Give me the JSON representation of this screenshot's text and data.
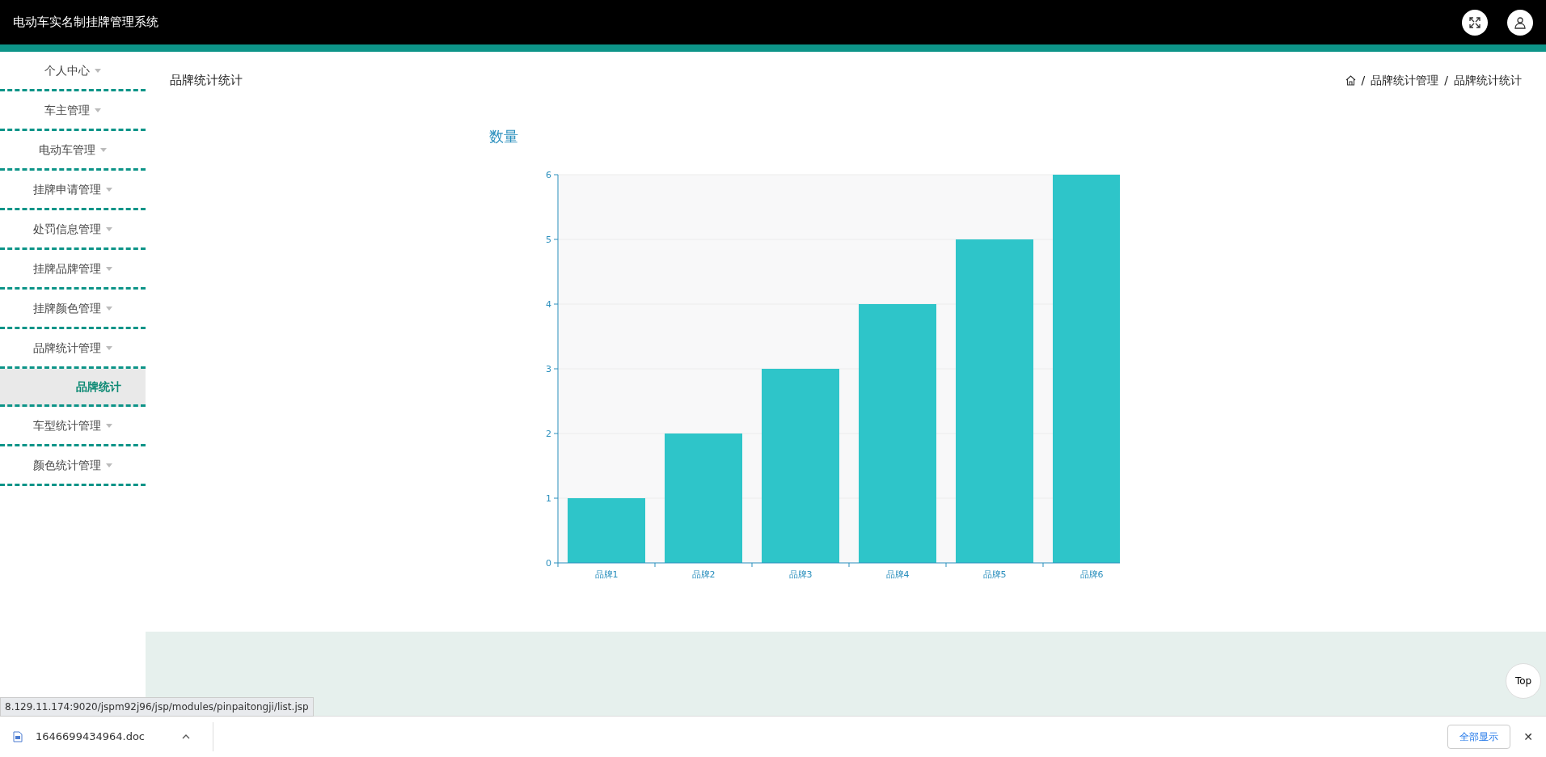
{
  "header": {
    "title": "电动车实名制挂牌管理系统"
  },
  "sidebar": {
    "items": [
      {
        "label": "个人中心"
      },
      {
        "label": "车主管理"
      },
      {
        "label": "电动车管理"
      },
      {
        "label": "挂牌申请管理"
      },
      {
        "label": "处罚信息管理"
      },
      {
        "label": "挂牌品牌管理"
      },
      {
        "label": "挂牌颜色管理"
      },
      {
        "label": "品牌统计管理",
        "children": [
          {
            "label": "品牌统计",
            "selected": true
          }
        ]
      },
      {
        "label": "车型统计管理"
      },
      {
        "label": "颜色统计管理"
      }
    ]
  },
  "page": {
    "title": "品牌统计统计",
    "breadcrumb_separator": "/",
    "breadcrumb": [
      "品牌统计管理",
      "品牌统计统计"
    ]
  },
  "chart": {
    "chart_data": {
      "type": "bar",
      "title": "数量",
      "categories": [
        "品牌1",
        "品牌2",
        "品牌3",
        "品牌4",
        "品牌5",
        "品牌6"
      ],
      "values": [
        1,
        2,
        3,
        4,
        5,
        6
      ],
      "ylim": [
        0,
        6
      ],
      "grid": true,
      "yticks": [
        0,
        1,
        2,
        3,
        4,
        5,
        6
      ]
    }
  },
  "top_button": "Top",
  "browser": {
    "status_url": "8.129.11.174:9020/jspm92j96/jsp/modules/pinpaitongji/list.jsp",
    "download_file": "1646699434964.doc",
    "show_all_button": "全部显示",
    "close_symbol": "✕"
  }
}
